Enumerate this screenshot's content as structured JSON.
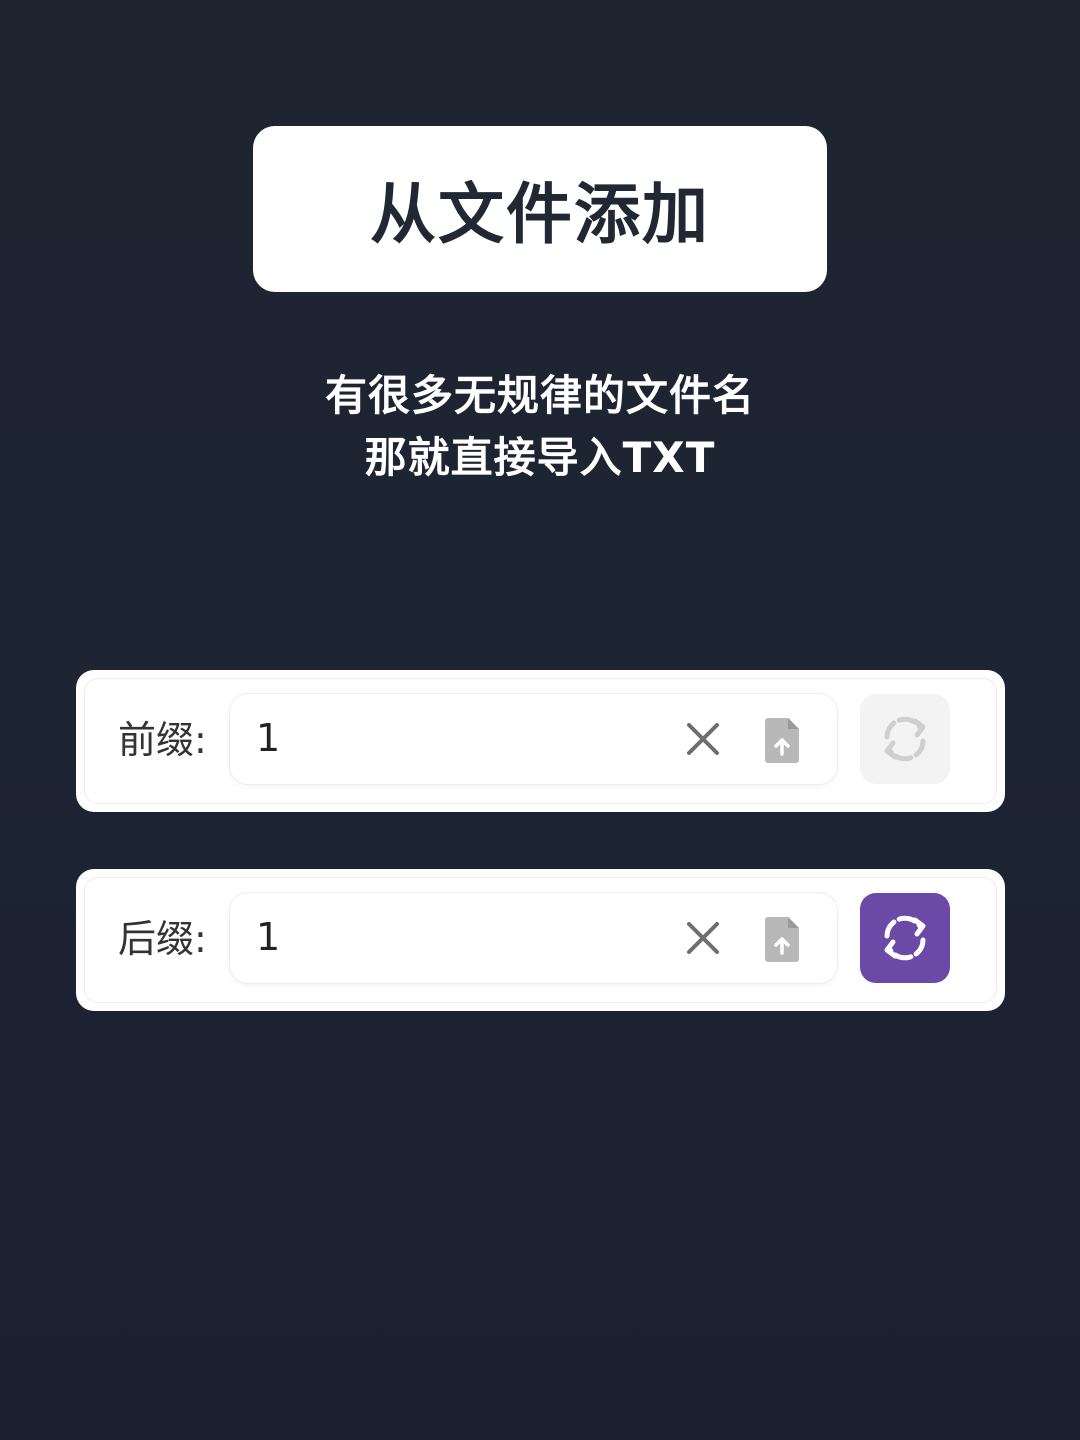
{
  "title": "从文件添加",
  "subtitle": {
    "line1": "有很多无规律的文件名",
    "line2": "那就直接导入TXT"
  },
  "rows": [
    {
      "label": "前缀:",
      "input_value": "1",
      "clear_icon": "close-icon",
      "upload_icon": "file-upload-icon",
      "convert_icon": "refresh-icon",
      "convert_state": "disabled"
    },
    {
      "label": "后缀:",
      "input_value": "1",
      "clear_icon": "close-icon",
      "upload_icon": "file-upload-icon",
      "convert_icon": "refresh-icon",
      "convert_state": "active"
    }
  ],
  "colors": {
    "background": "#1d2432",
    "accent": "#6a4aa6",
    "disabled_button": "#f3f3f3",
    "icon_gray": "#8a8a8a"
  }
}
